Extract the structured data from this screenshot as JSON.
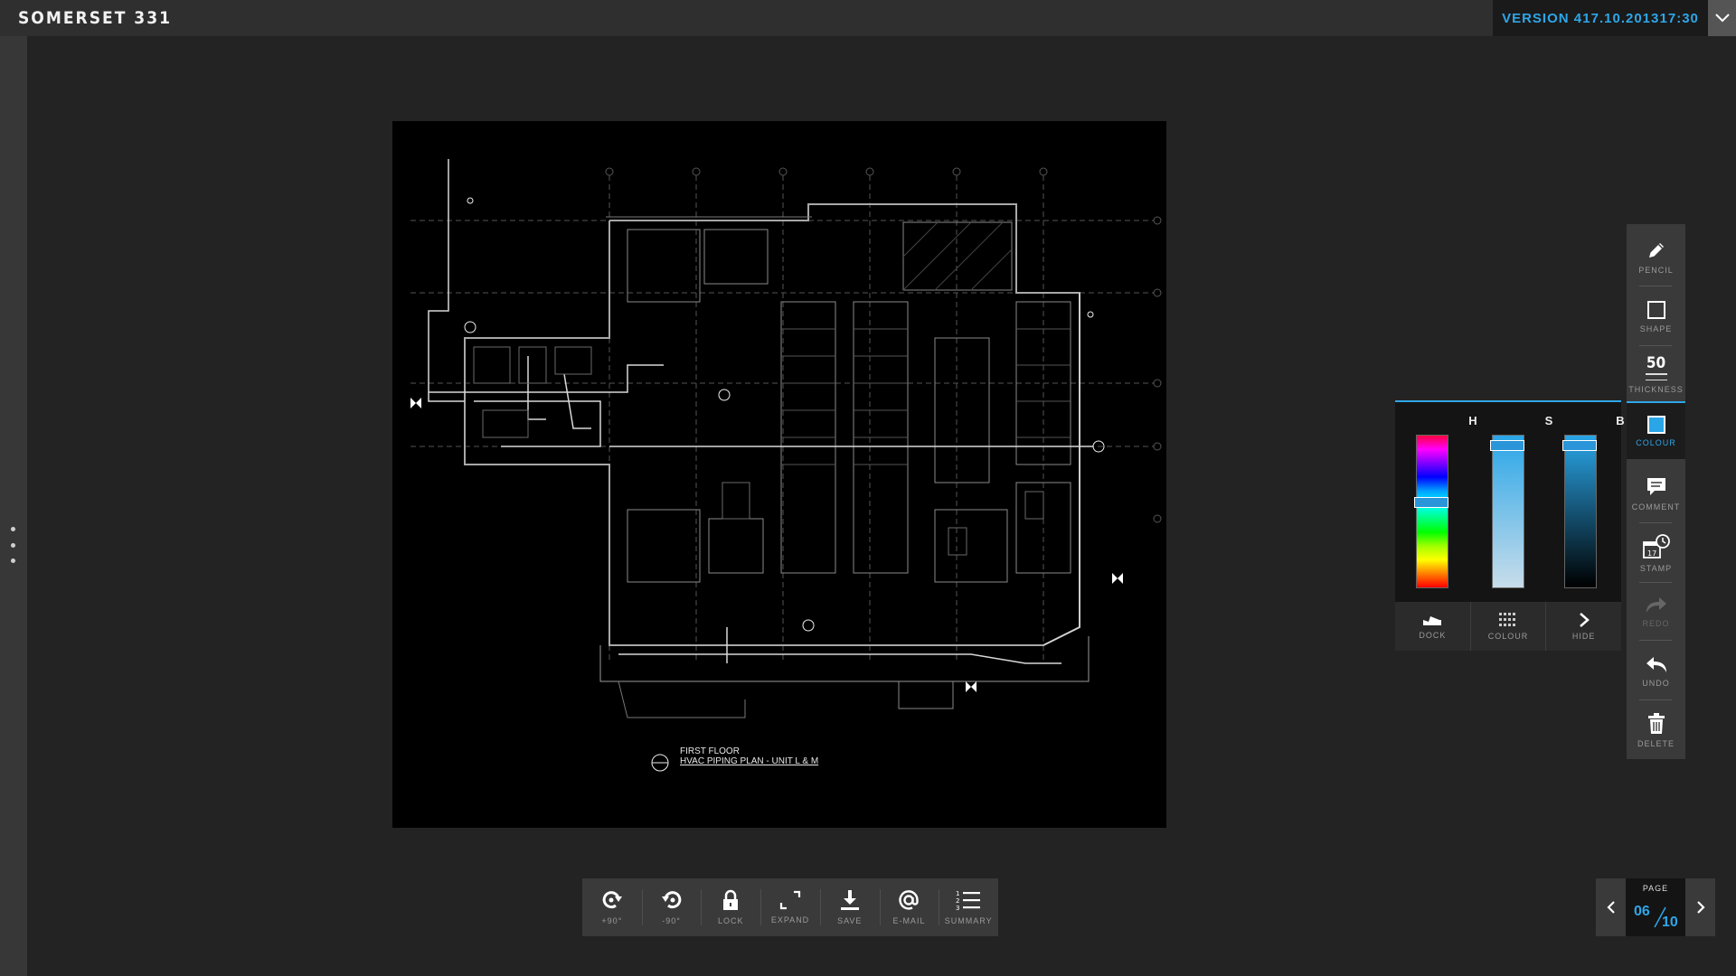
{
  "app": {
    "title": "SOMERSET 331"
  },
  "header": {
    "version": "VERSION 4",
    "date": "17.10.2013",
    "time": "17:30"
  },
  "drawing": {
    "caption_title": "FIRST FLOOR",
    "caption_subtitle": "HVAC PIPING PLAN - UNIT L & M"
  },
  "tools": {
    "pencil": "PENCIL",
    "shape": "SHAPE",
    "thickness_value": "50",
    "thickness": "THICKNESS",
    "colour": "COLOUR",
    "comment": "COMMENT",
    "stamp": "STAMP",
    "redo": "REDO",
    "undo": "UNDO",
    "delete": "DELETE"
  },
  "colour_picker": {
    "h_label": "H",
    "s_label": "S",
    "b_label": "B",
    "h_value": 0.42,
    "s_value": 0.05,
    "b_value": 0.05,
    "selected_color": "#2aa6e8",
    "dock": "DOCK",
    "colour": "COLOUR",
    "hide": "HIDE"
  },
  "bottom_toolbar": {
    "rotate_cw": "+90°",
    "rotate_ccw": "-90°",
    "lock": "LOCK",
    "expand": "EXPAND",
    "save": "SAVE",
    "email": "E-MAIL",
    "summary": "SUMMARY"
  },
  "pagination": {
    "label": "PAGE",
    "current": "06",
    "total": "10"
  },
  "colors": {
    "accent": "#2fa6e8",
    "background": "#232323",
    "panel": "#3a3a3a"
  }
}
